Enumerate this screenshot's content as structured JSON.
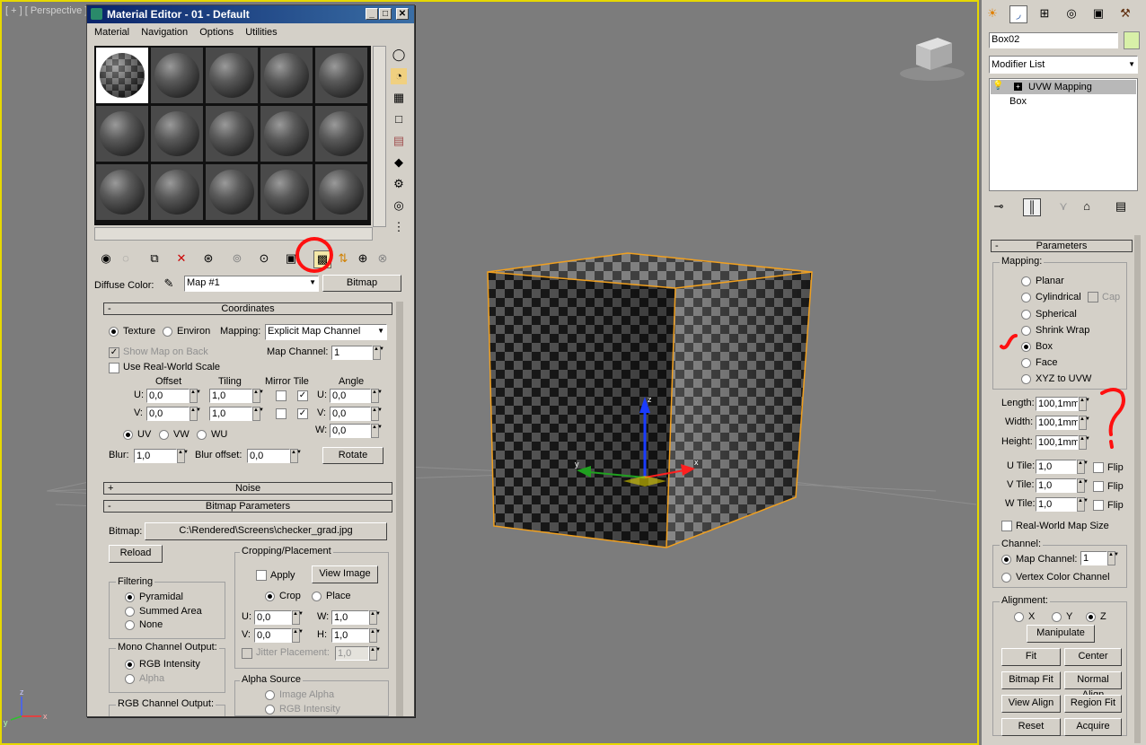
{
  "viewport": {
    "label": "[ + ] [ Perspective ]",
    "axis_labels": {
      "x": "x",
      "y": "y",
      "z": "z"
    }
  },
  "mated": {
    "title": "Material Editor - 01 - Default",
    "menu": [
      "Material",
      "Navigation",
      "Options",
      "Utilities"
    ],
    "diffuse_label": "Diffuse Color:",
    "map_name": "Map #1",
    "map_type": "Bitmap",
    "coords": {
      "header": "Coordinates",
      "texture": "Texture",
      "environ": "Environ",
      "mapping_label": "Mapping:",
      "mapping_value": "Explicit Map Channel",
      "show_map_on_back": "Show Map on Back",
      "map_channel_label": "Map Channel:",
      "map_channel": "1",
      "use_real_world": "Use Real-World Scale",
      "offset": "Offset",
      "tiling": "Tiling",
      "mirror_tile": "Mirror Tile",
      "angle": "Angle",
      "u": "U:",
      "v": "V:",
      "w": "W:",
      "u_offset": "0,0",
      "v_offset": "0,0",
      "u_tiling": "1,0",
      "v_tiling": "1,0",
      "u_angle": "0,0",
      "v_angle": "0,0",
      "w_angle": "0,0",
      "uv": "UV",
      "vw": "VW",
      "wu": "WU",
      "blur_label": "Blur:",
      "blur": "1,0",
      "blur_offset_label": "Blur offset:",
      "blur_offset": "0,0",
      "rotate": "Rotate"
    },
    "noise_header": "Noise",
    "bitmap_header": "Bitmap Parameters",
    "bitmap": {
      "label": "Bitmap:",
      "path": "C:\\Rendered\\Screens\\checker_grad.jpg",
      "reload": "Reload",
      "cropping": "Cropping/Placement",
      "apply": "Apply",
      "view_image": "View Image",
      "crop": "Crop",
      "place": "Place",
      "u": "U:",
      "v": "V:",
      "w": "W:",
      "h": "H:",
      "u_val": "0,0",
      "v_val": "0,0",
      "w_val": "1,0",
      "h_val": "1,0",
      "jitter": "Jitter Placement:",
      "jitter_val": "1,0",
      "filtering": "Filtering",
      "pyramidal": "Pyramidal",
      "summed": "Summed Area",
      "none": "None",
      "mono": "Mono Channel Output:",
      "rgb_intensity": "RGB Intensity",
      "alpha": "Alpha",
      "rgb_out": "RGB Channel Output:",
      "alpha_source": "Alpha Source",
      "image_alpha": "Image Alpha",
      "rgb_intensity2": "RGB Intensity"
    }
  },
  "cmd": {
    "object_name": "Box02",
    "modifier_list": "Modifier List",
    "stack": [
      "UVW Mapping",
      "Box"
    ],
    "params_header": "Parameters",
    "mapping": "Mapping:",
    "planar": "Planar",
    "cylindrical": "Cylindrical",
    "cap": "Cap",
    "spherical": "Spherical",
    "shrink_wrap": "Shrink Wrap",
    "box": "Box",
    "face": "Face",
    "xyz_to_uvw": "XYZ to UVW",
    "length_label": "Length:",
    "width_label": "Width:",
    "height_label": "Height:",
    "length": "100,1mm",
    "width": "100,1mm",
    "height": "100,1mm",
    "u_tile_label": "U Tile:",
    "v_tile_label": "V Tile:",
    "w_tile_label": "W Tile:",
    "u_tile": "1,0",
    "v_tile": "1,0",
    "w_tile": "1,0",
    "flip": "Flip",
    "real_world": "Real-World Map Size",
    "channel": "Channel:",
    "map_channel_label": "Map Channel:",
    "map_channel": "1",
    "vertex_color": "Vertex Color Channel",
    "alignment": "Alignment:",
    "x": "X",
    "y": "Y",
    "z": "Z",
    "manipulate": "Manipulate",
    "fit": "Fit",
    "center": "Center",
    "bitmap_fit": "Bitmap Fit",
    "normal_align": "Normal Align",
    "view_align": "View Align",
    "region_fit": "Region Fit",
    "reset": "Reset",
    "acquire": "Acquire"
  },
  "colors": {
    "accent": "#e6d800",
    "title_bar": "#0a246a",
    "annotation": "#ff0000",
    "object_color": "#d8f0a8"
  }
}
